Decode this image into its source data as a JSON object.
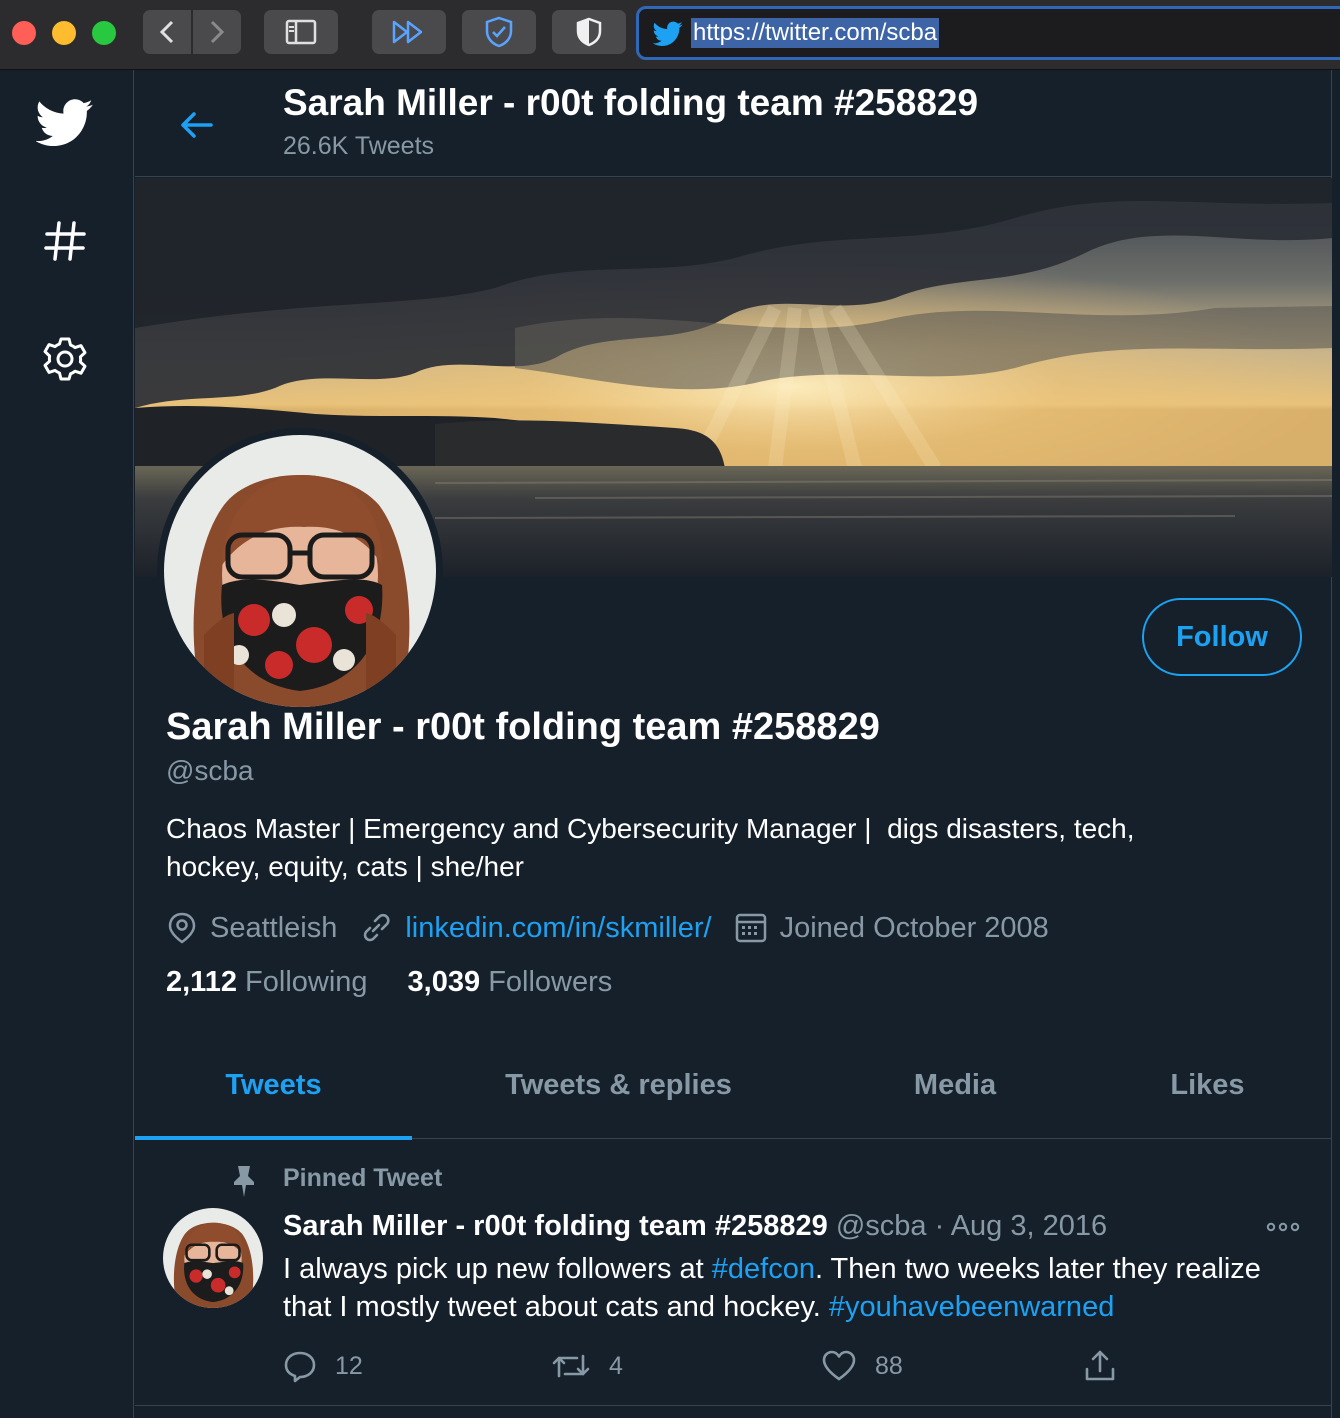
{
  "browser": {
    "url": "https://twitter.com/scba"
  },
  "nav": {
    "icons": [
      "twitter-bird-icon",
      "hashtag-icon",
      "settings-gear-icon"
    ]
  },
  "header": {
    "display_name": "Sarah Miller - r00t folding team #258829",
    "tweet_count": "26.6K Tweets"
  },
  "profile": {
    "display_name": "Sarah Miller - r00t folding team #258829",
    "handle": "@scba",
    "follow_label": "Follow",
    "bio_line1": "Chaos Master | Emergency and Cybersecurity Manager |  digs disasters, tech,",
    "bio_line2": "hockey, equity, cats | she/her",
    "location": "Seattleish",
    "website": "linkedin.com/in/skmiller/",
    "joined": "Joined October 2008",
    "following_count": "2,112",
    "following_label": "Following",
    "followers_count": "3,039",
    "followers_label": "Followers"
  },
  "tabs": [
    {
      "label": "Tweets",
      "active": true
    },
    {
      "label": "Tweets & replies",
      "active": false
    },
    {
      "label": "Media",
      "active": false
    },
    {
      "label": "Likes",
      "active": false
    }
  ],
  "pinned_tweet": {
    "pinned_label": "Pinned Tweet",
    "author_name": "Sarah Miller - r00t folding team #258829",
    "meta": "@scba · Aug 3, 2016",
    "text_part1": "I always pick up new followers at ",
    "hashtag1": "#defcon",
    "text_part2": ". Then two weeks later they realize that I mostly tweet about cats and hockey. ",
    "hashtag2": "#youhavebeenwarned",
    "replies": "12",
    "retweets": "4",
    "likes": "88"
  },
  "colors": {
    "background": "#15202b",
    "accent": "#1da1f2",
    "secondary_text": "#8899a6",
    "border": "#38444d"
  }
}
